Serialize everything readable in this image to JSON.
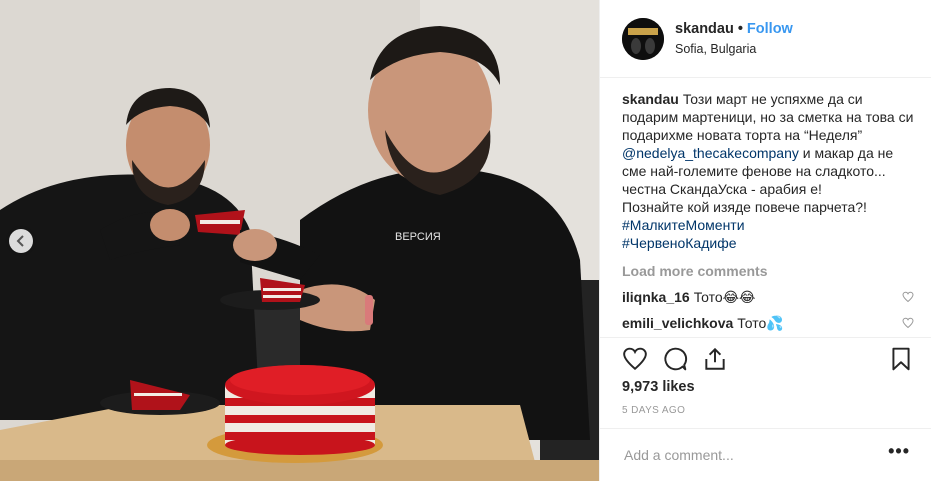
{
  "post": {
    "photo_alt": "Two men eating red velvet cake",
    "hoodie_text": "ВЕРСИЯ"
  },
  "header": {
    "username": "skandau",
    "separator": "•",
    "follow_label": "Follow",
    "location": "Sofia, Bulgaria"
  },
  "caption": {
    "username": "skandau",
    "line1": "Този март не успяхме да си подарим мартеници, но за сметка на това си",
    "line2": "подарихме новата торта на “Неделя”",
    "mention": "@nedelya_thecakecompany",
    "line3_rest": " и макар да не сме най-големите фенове на сладкото...",
    "line4": "честна СкандаУска - арабия е!",
    "line5": "Познайте кой изяде повече парчета?!",
    "hashtag1": "#МалкитеМоменти",
    "hashtag2": "#ЧервеноКадифе"
  },
  "comments": {
    "load_more_label": "Load more comments",
    "items": [
      {
        "user": "iliqnka_16",
        "text": "Тото😂😂"
      },
      {
        "user": "emili_velichkova",
        "text": "Тото💦"
      }
    ]
  },
  "actions": {
    "likes": "9,973 likes",
    "age": "5 DAYS AGO"
  },
  "composer": {
    "placeholder": "Add a comment...",
    "more_label": "•••"
  },
  "colors": {
    "accent": "#3897f0",
    "link": "#003569",
    "muted": "#999999",
    "border": "#efefef",
    "cake_red": "#c8141c"
  }
}
